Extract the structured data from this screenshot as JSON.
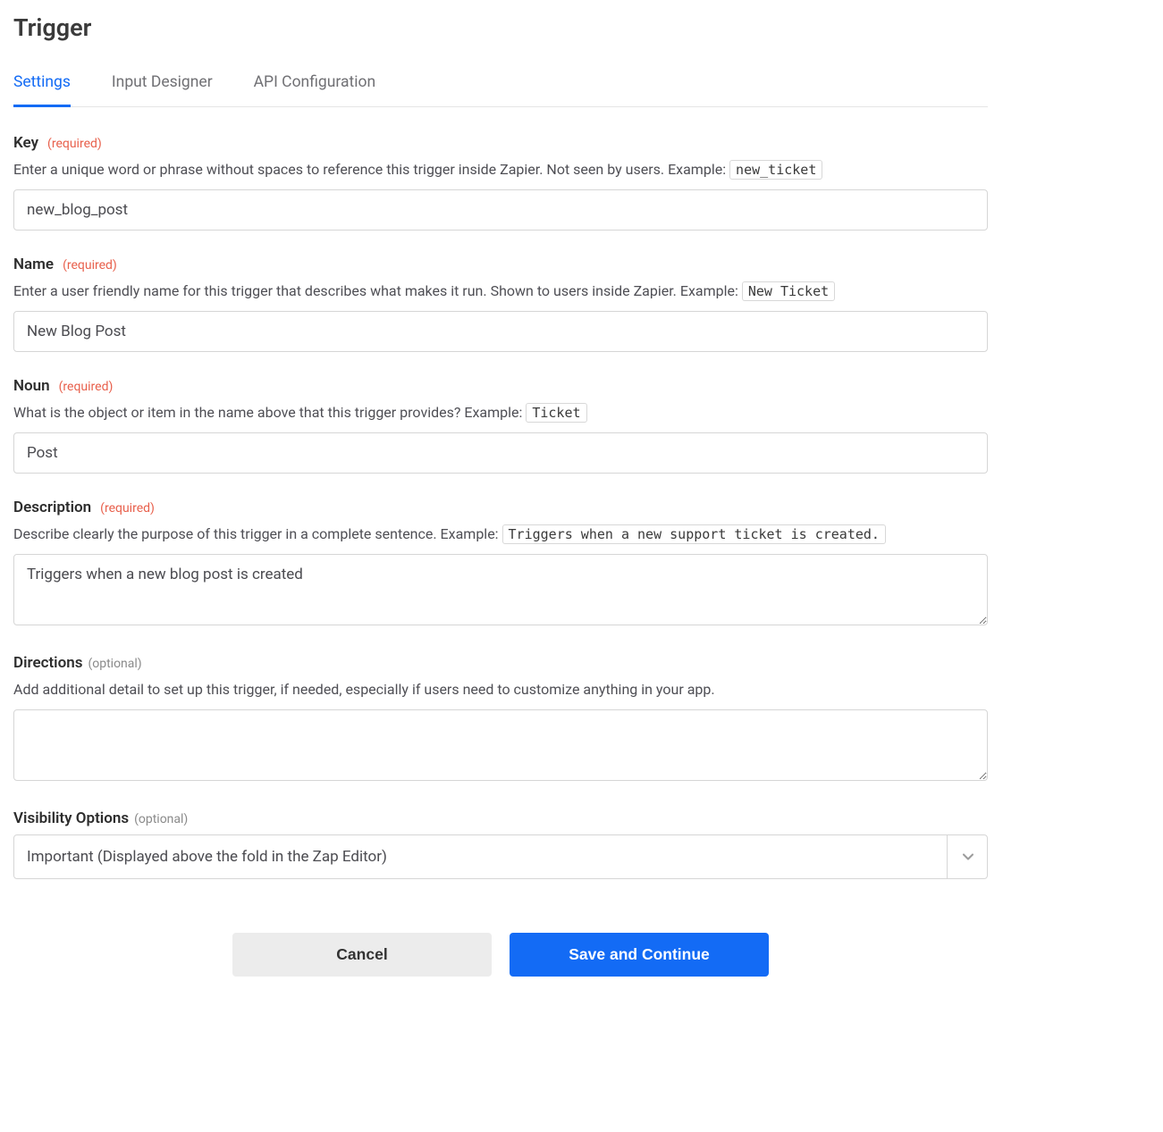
{
  "page_title": "Trigger",
  "tabs": [
    {
      "label": "Settings",
      "active": true
    },
    {
      "label": "Input Designer",
      "active": false
    },
    {
      "label": "API Configuration",
      "active": false
    }
  ],
  "required_badge": "(required)",
  "optional_badge": "(optional)",
  "fields": {
    "key": {
      "label": "Key",
      "helper": "Enter a unique word or phrase without spaces to reference this trigger inside Zapier. Not seen by users. Example: ",
      "example_code": "new_ticket",
      "value": "new_blog_post"
    },
    "name": {
      "label": "Name",
      "helper": "Enter a user friendly name for this trigger that describes what makes it run. Shown to users inside Zapier. Example: ",
      "example_code": "New Ticket",
      "value": "New Blog Post"
    },
    "noun": {
      "label": "Noun",
      "helper": "What is the object or item in the name above that this trigger provides? Example: ",
      "example_code": "Ticket",
      "value": "Post"
    },
    "description": {
      "label": "Description",
      "helper": "Describe clearly the purpose of this trigger in a complete sentence. Example: ",
      "example_code": "Triggers when a new support ticket is created.",
      "value": "Triggers when a new blog post is created"
    },
    "directions": {
      "label": "Directions",
      "helper": "Add additional detail to set up this trigger, if needed, especially if users need to customize anything in your app.",
      "value": ""
    },
    "visibility": {
      "label": "Visibility Options",
      "selected": "Important (Displayed above the fold in the Zap Editor)"
    }
  },
  "buttons": {
    "cancel": "Cancel",
    "save": "Save and Continue"
  }
}
